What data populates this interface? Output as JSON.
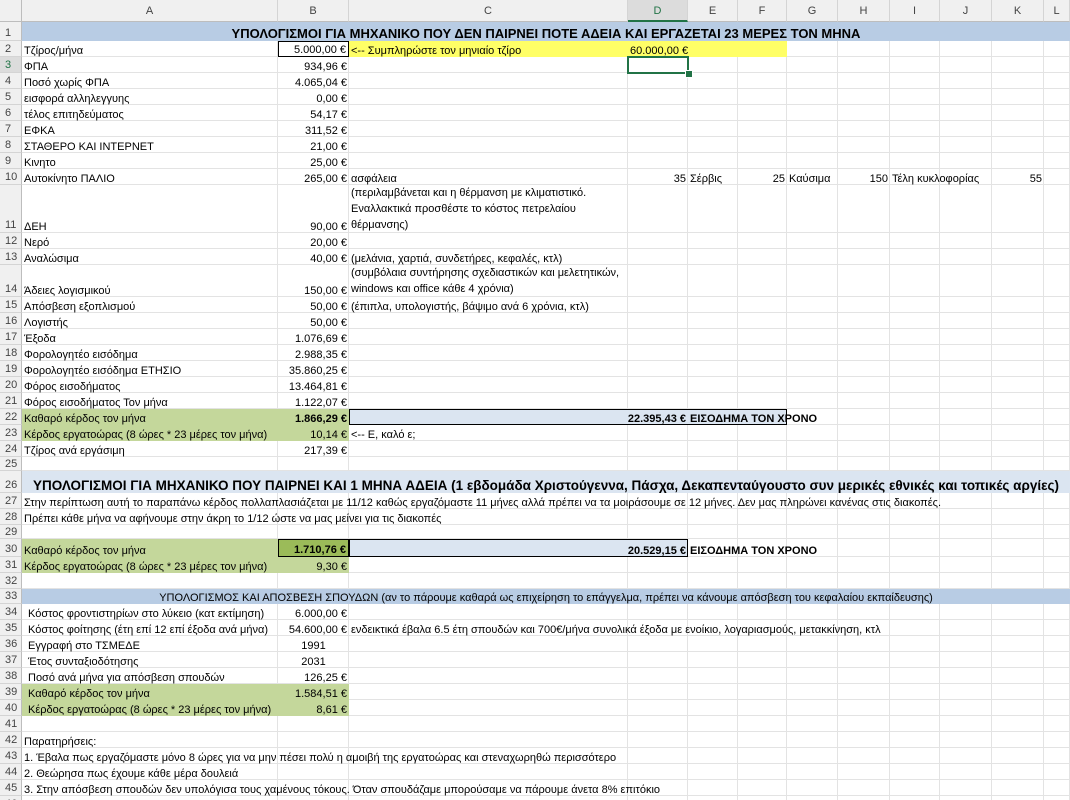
{
  "columns": [
    "A",
    "B",
    "C",
    "D",
    "E",
    "F",
    "G",
    "H",
    "I",
    "J",
    "K",
    "L"
  ],
  "selected_column": "D",
  "selected_row": "3",
  "title1": "ΥΠΟΛΟΓΙΣΜΟΙ ΓΙΑ ΜΗΧΑΝΙΚΟ ΠΟΥ ΔΕΝ ΠΑΙΡΝΕΙ ΠΟΤΕ ΑΔΕΙΑ ΚΑΙ ΕΡΓΑΖΕΤΑΙ 23 ΜΕΡΕΣ ΤΟΝ ΜΗΝΑ",
  "title2": "ΥΠΟΛΟΓΙΣΜΟΙ ΓΙΑ ΜΗΧΑΝΙΚΟ ΠΟΥ ΠΑΙΡΝΕΙ ΚΑΙ 1 ΜΗΝΑ ΑΔΕΙΑ (1 εβδομάδα Χριστούγεννα, Πάσχα, Δεκαπενταύγουστο συν μερικές εθνικές και τοπικές αργίες)",
  "title3": "ΥΠΟΛΟΓΙΣΜΟΣ ΚΑΙ ΑΠΟΣΒΕΣΗ ΣΠΟΥΔΩΝ (αν το πάρουμε καθαρά ως επιχείρηση το επάγγελμα, πρέπει να κάνουμε απόσβεση του κεφαλαίου εκπαίδευσης)",
  "r2": {
    "a": "Τζίρος/μήνα",
    "b": "5.000,00 €",
    "c": "<-- Συμπληρώστε τον μηνιαίο τζίρο",
    "d": "60.000,00 €"
  },
  "r3": {
    "a": "ΦΠΑ",
    "b": "934,96 €"
  },
  "r4": {
    "a": "Ποσό χωρίς ΦΠΑ",
    "b": "4.065,04 €"
  },
  "r5": {
    "a": "εισφορά αλληλεγγυης",
    "b": "0,00 €"
  },
  "r6": {
    "a": "τέλος επιτηδεύματος",
    "b": "54,17 €"
  },
  "r7": {
    "a": "ΕΦΚΑ",
    "b": "311,52 €"
  },
  "r8": {
    "a": "ΣΤΑΘΕΡΟ ΚΑΙ ΙΝΤΕΡΝΕΤ",
    "b": "21,00 €"
  },
  "r9": {
    "a": "Κινητο",
    "b": "25,00 €"
  },
  "r10": {
    "a": "Αυτοκίνητο ΠΑΛΙΟ",
    "b": "265,00 €",
    "c": "ασφάλεια",
    "d": "35",
    "e": "Σέρβις",
    "f": "25",
    "g": "Καύσιμα",
    "h": "150",
    "i": "Τέλη κυκλοφορίας",
    "k": "55"
  },
  "r11": {
    "a": "ΔΕΗ",
    "b": "90,00 €",
    "c": "(περιλαμβάνεται και η θέρμανση με κλιματιστικό. Εναλλακτικά προσθέστε το κόστος πετρελαίου θέρμανσης)"
  },
  "r12": {
    "a": "Νερό",
    "b": "20,00 €"
  },
  "r13": {
    "a": "Αναλώσιμα",
    "b": "40,00 €",
    "c": "(μελάνια, χαρτιά, συνδετήρες, κεφαλές, κτλ)"
  },
  "r14": {
    "a": "Άδειες λογισμικού",
    "b": "150,00 €",
    "c": "(συμβόλαια συντήρησης σχεδιαστικών και μελετητικών, windows και office κάθε 4 χρόνια)"
  },
  "r15": {
    "a": "Απόσβεση εξοπλισμού",
    "b": "50,00 €",
    "c": "(έπιπλα, υπολογιστής, βάψιμο ανά 6 χρόνια, κτλ)"
  },
  "r16": {
    "a": "Λογιστής",
    "b": "50,00 €"
  },
  "r17": {
    "a": "Έξοδα",
    "b": "1.076,69 €"
  },
  "r18": {
    "a": "Φορολογητέο εισόδημα",
    "b": "2.988,35 €"
  },
  "r19": {
    "a": "Φορολογητέο εισόδημα ΕΤΗΣΙΟ",
    "b": "35.860,25 €"
  },
  "r20": {
    "a": "Φόρος εισοδήματος",
    "b": "13.464,81 €"
  },
  "r21": {
    "a": "Φόρος εισοδήματος Τον μήνα",
    "b": "1.122,07 €"
  },
  "r22": {
    "a": "Καθαρό κέρδος τον μήνα",
    "b": "1.866,29 €",
    "d": "22.395,43 €",
    "e": "ΕΙΣΟΔΗΜΑ ΤΟΝ ΧΡΟΝΟ"
  },
  "r23": {
    "a": "Κέρδος εργατοώρας (8 ώρες * 23 μέρες τον μήνα)",
    "b": "10,14 €",
    "c": "<-- Ε, καλό ε;"
  },
  "r24": {
    "a": "Τζίρος ανά εργάσιμη",
    "b": "217,39 €"
  },
  "r27": "Στην περίπτωση αυτή το παραπάνω κέρδος πολλαπλασιάζεται με 11/12 καθώς εργαζόμαστε 11 μήνες αλλά πρέπει να τα μοιράσουμε σε 12 μήνες. Δεν μας πληρώνει κανένας στις διακοπές.",
  "r28": "Πρέπει κάθε μήνα να αφήνουμε στην άκρη το 1/12 ώστε να μας μείνει για τις διακοπές",
  "r30": {
    "a": "Καθαρό κέρδος τον μήνα",
    "b": "1.710,76 €",
    "d": "20.529,15 €",
    "e": "ΕΙΣΟΔΗΜΑ ΤΟΝ ΧΡΟΝΟ"
  },
  "r31": {
    "a": "Κέρδος εργατοώρας (8 ώρες * 23 μέρες τον μήνα)",
    "b": "9,30 €"
  },
  "r34": {
    "a": "Κόστος φροντιστηρίων στο λύκειο (κατ εκτίμηση)",
    "b": "6.000,00 €"
  },
  "r35": {
    "a": "Κόστος φοίτησης (έτη επί 12 επί έξοδα ανά μήνα)",
    "b": "54.600,00 €",
    "c": "ενδεικτικά έβαλα 6.5 έτη σπουδών και 700€/μήνα συνολικά έξοδα με ενοίκιο, λογαριασμούς, μετακκίνηση, κτλ"
  },
  "r36": {
    "a": "Εγγραφή στο ΤΣΜΕΔΕ",
    "b": "1991"
  },
  "r37": {
    "a": "Έτος συνταξιοδότησης",
    "b": "2031"
  },
  "r38": {
    "a": "Ποσό ανά μήνα για απόσβεση σπουδών",
    "b": "126,25 €"
  },
  "r39": {
    "a": "Καθαρό κέρδος τον μήνα",
    "b": "1.584,51 €"
  },
  "r40": {
    "a": "Κέρδος εργατοώρας (8 ώρες * 23 μέρες τον μήνα)",
    "b": "8,61 €"
  },
  "r42": "Παρατηρήσεις:",
  "r43": "1. Έβαλα πως εργαζόμαστε μόνο 8 ώρες για να μην πέσει πολύ η αμοιβή της εργατοώρας και στεναχωρηθώ περισσότερο",
  "r44": "2. Θεώρησα πως έχουμε κάθε μέρα δουλειά",
  "r45": "3. Στην απόσβεση σπουδών δεν υπολόγισα τους χαμένους τόκους. Όταν σπουδάζαμε μπορούσαμε να πάρουμε άνετα 8% επιτόκιο"
}
